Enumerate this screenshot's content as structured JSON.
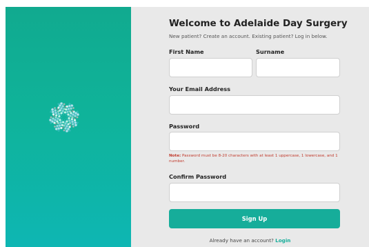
{
  "form": {
    "title": "Welcome to Adelaide Day Surgery",
    "subtitle": "New patient? Create an account. Existing patient? Log in below.",
    "first_name_label": "First Name",
    "first_name_value": "",
    "surname_label": "Surname",
    "surname_value": "",
    "email_label": "Your Email Address",
    "email_value": "",
    "password_label": "Password",
    "password_value": "",
    "note_prefix": "Note:",
    "note_text": " Password must be 8-20 characters with at least 1 uppercase, 1 lowercase, and 1 number.",
    "confirm_password_label": "Confirm Password",
    "confirm_password_value": "",
    "signup_label": "Sign Up",
    "already_text": "Already have an account?",
    "login_link": "Login"
  },
  "colors": {
    "brand_teal": "#16ad9a",
    "note_red": "#c0392b"
  },
  "icons": {
    "logo": "pinwheel-logo-icon"
  }
}
